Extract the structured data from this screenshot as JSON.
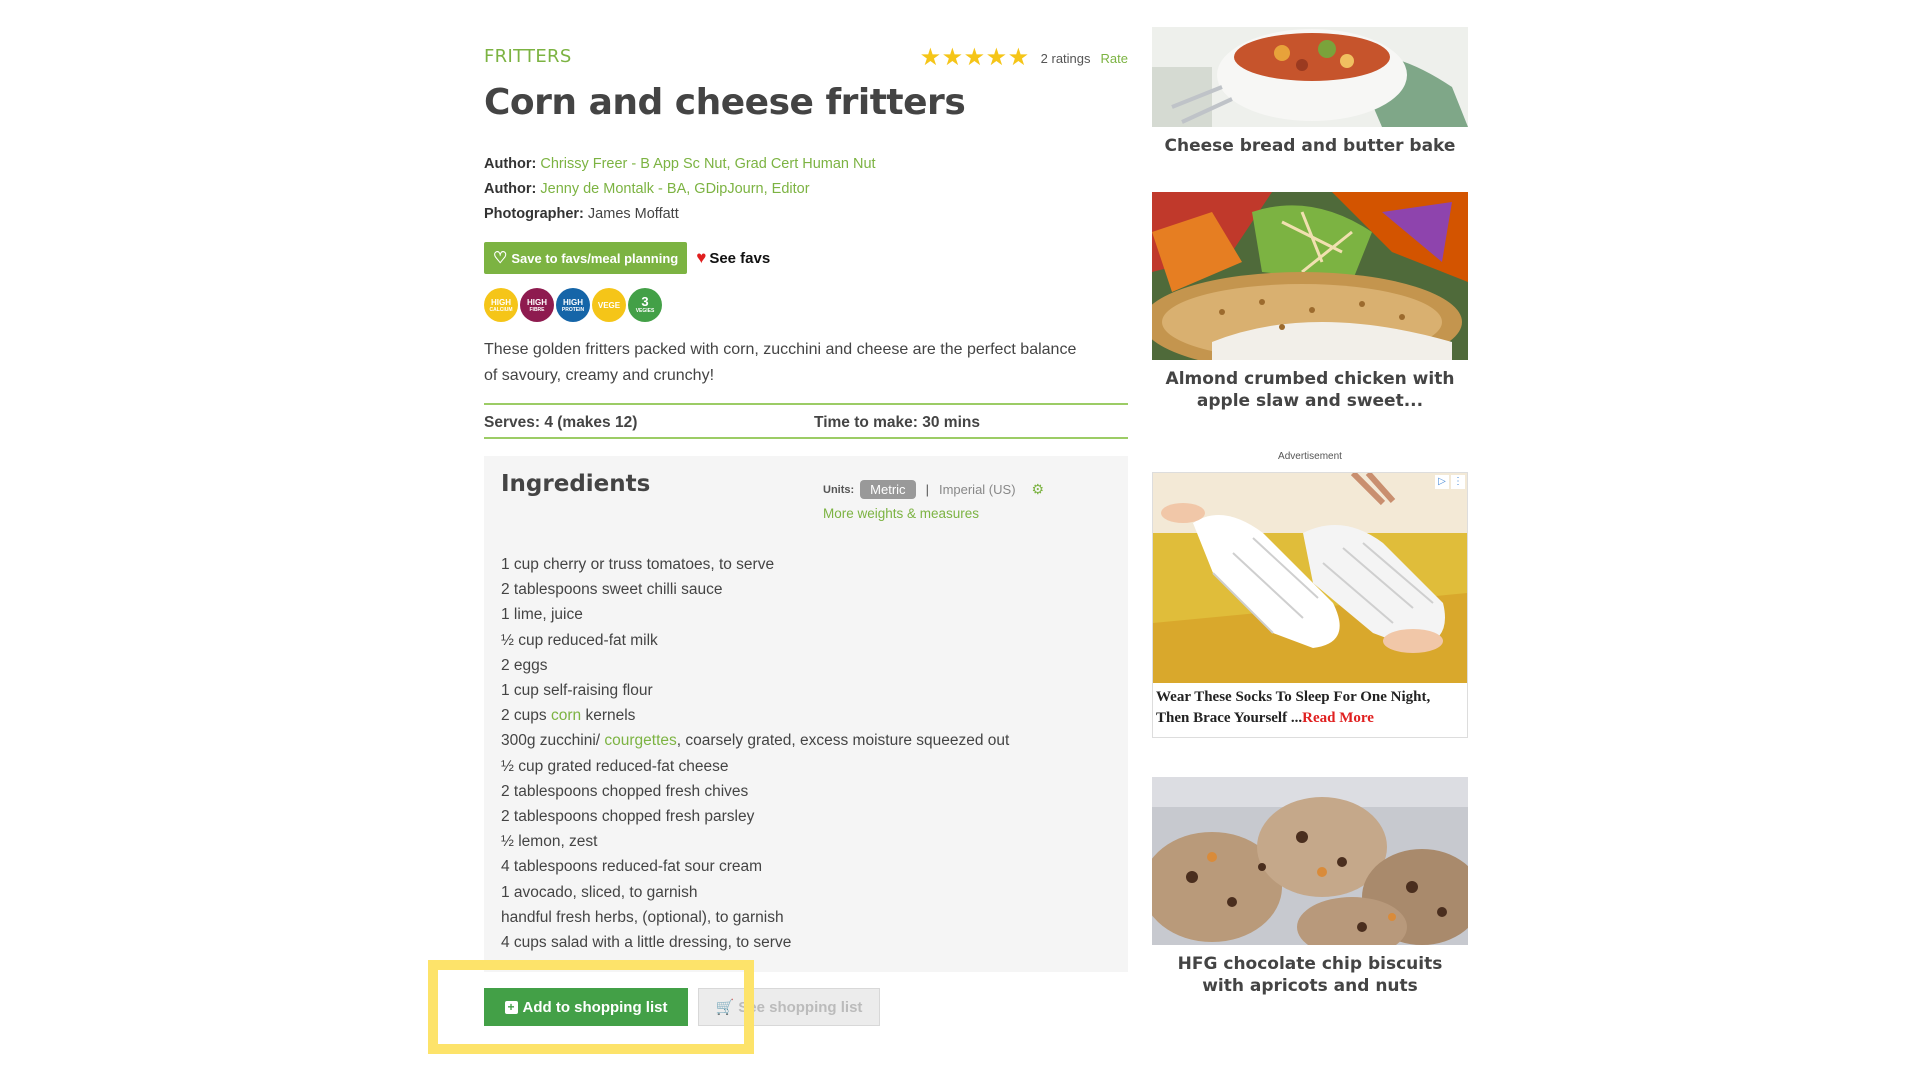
{
  "recipe": {
    "category": "FRITTERS",
    "title": "Corn and cheese fritters",
    "rating": {
      "stars": 5,
      "count_text": "2 ratings",
      "rate_label": "Rate"
    },
    "credits": [
      {
        "label": "Author:",
        "value": "Chrissy Freer - B App Sc Nut, Grad Cert Human Nut",
        "is_link": true
      },
      {
        "label": "Author:",
        "value": "Jenny de Montalk - BA, GDipJourn, Editor",
        "is_link": true
      },
      {
        "label": "Photographer:",
        "value": "James Moffatt",
        "is_link": false
      }
    ],
    "save_button": "Save to favs/meal planning",
    "see_favs": "See favs",
    "badges": [
      {
        "top": "HIGH",
        "bottom": "CALCIUM",
        "color": "#f5c518"
      },
      {
        "top": "HIGH",
        "bottom": "FIBRE",
        "color": "#8e1b4f"
      },
      {
        "top": "HIGH",
        "bottom": "PROTEIN",
        "color": "#1565a8"
      },
      {
        "top": "VEGE",
        "bottom": "",
        "color": "#f5c518"
      },
      {
        "top": "3",
        "bottom": "VEGIES",
        "color": "#43a047"
      }
    ],
    "description": "These golden fritters packed with corn, zucchini and cheese are the perfect balance of savoury, creamy and crunchy!",
    "serves": "Serves: 4 (makes 12)",
    "time": "Time to make: 30 mins"
  },
  "ingredients": {
    "title": "Ingredients",
    "units_label": "Units:",
    "metric": "Metric",
    "separator": "|",
    "imperial": "Imperial (US)",
    "more_link": "More weights & measures",
    "items": [
      {
        "pre": "1 cup cherry or truss tomatoes, to serve",
        "link": "",
        "post": ""
      },
      {
        "pre": "2 tablespoons sweet chilli sauce",
        "link": "",
        "post": ""
      },
      {
        "pre": "1 lime, juice",
        "link": "",
        "post": ""
      },
      {
        "pre": "½ cup reduced-fat milk",
        "link": "",
        "post": ""
      },
      {
        "pre": "2 eggs",
        "link": "",
        "post": ""
      },
      {
        "pre": "1 cup self-raising flour",
        "link": "",
        "post": ""
      },
      {
        "pre": "2 cups ",
        "link": "corn",
        "post": " kernels"
      },
      {
        "pre": "300g zucchini/ ",
        "link": "courgettes",
        "post": ", coarsely grated, excess moisture squeezed out"
      },
      {
        "pre": "½ cup grated reduced-fat cheese",
        "link": "",
        "post": ""
      },
      {
        "pre": "2 tablespoons chopped fresh chives",
        "link": "",
        "post": ""
      },
      {
        "pre": "2 tablespoons chopped fresh parsley",
        "link": "",
        "post": ""
      },
      {
        "pre": "½ lemon, zest",
        "link": "",
        "post": ""
      },
      {
        "pre": "4 tablespoons reduced-fat sour cream",
        "link": "",
        "post": ""
      },
      {
        "pre": "1 avocado, sliced, to garnish",
        "link": "",
        "post": ""
      },
      {
        "pre": "handful fresh herbs, (optional), to garnish",
        "link": "",
        "post": ""
      },
      {
        "pre": "4 cups salad with a little dressing, to serve",
        "link": "",
        "post": ""
      }
    ]
  },
  "actions": {
    "add_to_list": "Add to shopping list",
    "see_list": "See shopping list"
  },
  "sidebar": {
    "cards": [
      {
        "title": "Cheese bread and butter bake"
      },
      {
        "title": "Almond crumbed chicken with apple slaw and sweet..."
      },
      {
        "title": "HFG chocolate chip biscuits with apricots and nuts"
      }
    ],
    "ad_label": "Advertisement",
    "ad_text": "Wear These Socks To Sleep For One Night, Then Brace Yourself ...",
    "ad_more": "Read More"
  },
  "colors": {
    "accent_green": "#7cb342",
    "button_green": "#43a047",
    "star_yellow": "#f5c518",
    "highlight_yellow": "#fde36a"
  }
}
